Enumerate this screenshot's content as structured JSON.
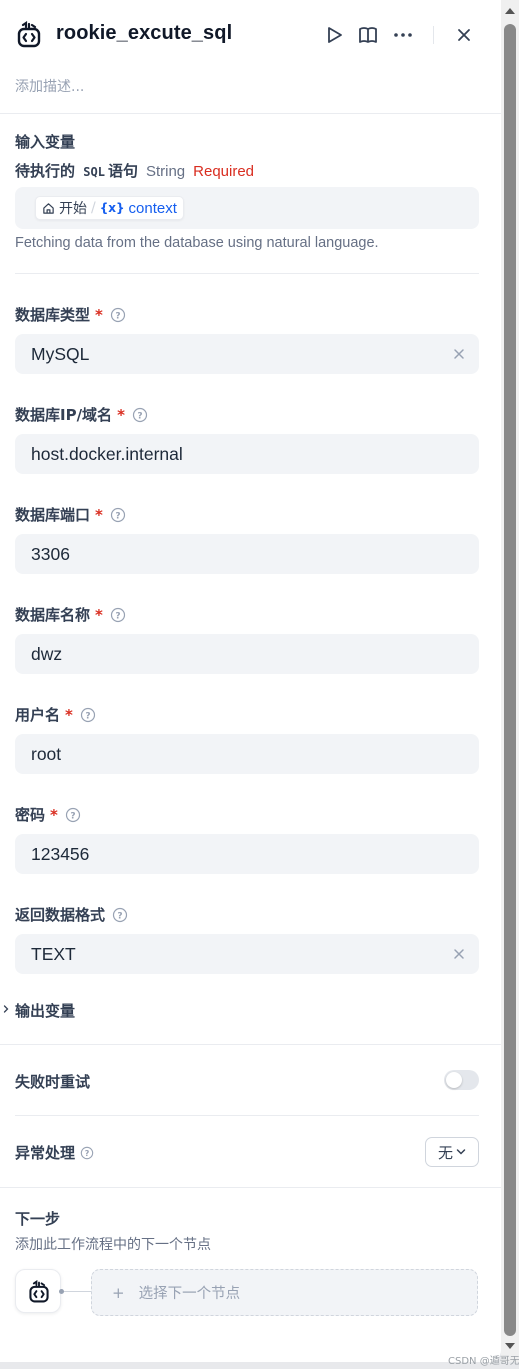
{
  "header": {
    "title": "rookie_excute_sql",
    "description_placeholder": "添加描述..."
  },
  "input_section": {
    "title": "输入变量",
    "variable": {
      "name_prefix": "待执行的",
      "name_code": "SQL",
      "name_suffix": "语句",
      "type": "String",
      "required": "Required",
      "source_node": "开始",
      "source_var": "context",
      "var_prefix": "{x}",
      "description": "Fetching data from the database using natural language."
    }
  },
  "fields": [
    {
      "label": "数据库类型",
      "required": "*",
      "value": "MySQL",
      "clearable": true
    },
    {
      "label": "数据库IP/域名",
      "required": "*",
      "value": "host.docker.internal"
    },
    {
      "label": "数据库端口",
      "required": "*",
      "value": "3306"
    },
    {
      "label": "数据库名称",
      "required": "*",
      "value": "dwz"
    },
    {
      "label": "用户名",
      "required": "*",
      "value": "root"
    },
    {
      "label": "密码",
      "required": "*",
      "value": "123456"
    },
    {
      "label": "返回数据格式",
      "value": "TEXT",
      "clearable": true
    }
  ],
  "output_section": {
    "title": "输出变量"
  },
  "retry": {
    "label": "失败时重试",
    "enabled": false
  },
  "error_handling": {
    "label": "异常处理",
    "value": "无"
  },
  "next_step": {
    "title": "下一步",
    "subtitle": "添加此工作流程中的下一个节点",
    "choose_label": "选择下一个节点",
    "plus": "+"
  },
  "watermark": "CSDN @遁哥无",
  "colors": {
    "accent": "#155eef",
    "required": "#d92d20",
    "field_bg": "#f2f4f7"
  }
}
